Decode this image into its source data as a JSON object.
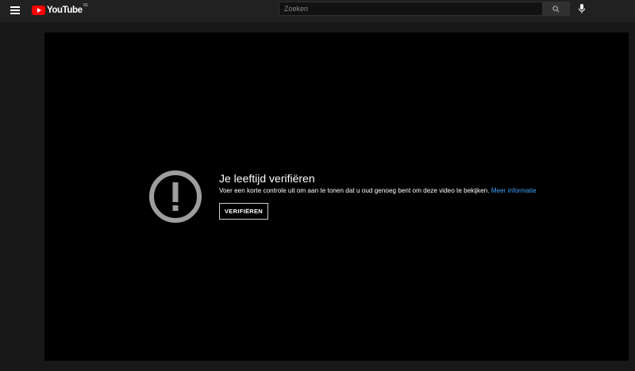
{
  "header": {
    "logo_text": "YouTube",
    "region_code": "BE",
    "search_placeholder": "Zoeken"
  },
  "player": {
    "age_gate": {
      "title": "Je leeftijd verifiëren",
      "description": "Voer een korte controle uit om aan te tonen dat u oud genoeg bent om deze video te bekijken.",
      "more_info_link": "Meer informatie",
      "verify_button": "VERIFIËREN"
    }
  },
  "colors": {
    "page_bg": "#181818",
    "header_bg": "#212121",
    "player_bg": "#000000",
    "brand_red": "#ff0000",
    "link_blue": "#3ea6ff",
    "icon_gray": "#9e9e9e"
  },
  "icons": {
    "menu": "hamburger-menu-icon",
    "logo": "youtube-logo-icon",
    "search": "search-icon",
    "mic": "microphone-icon",
    "warning": "exclamation-circle-icon"
  }
}
